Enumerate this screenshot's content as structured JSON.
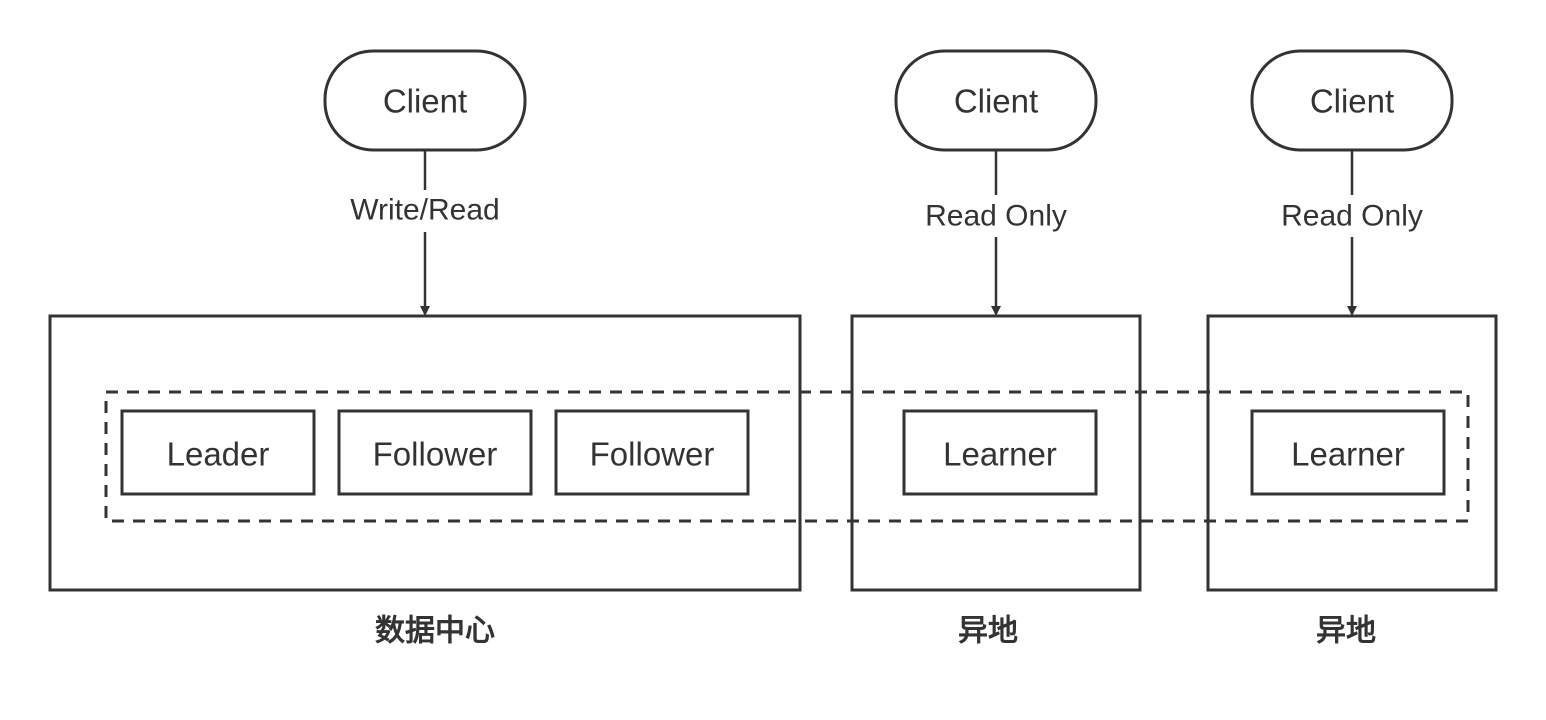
{
  "clients": [
    {
      "label": "Client",
      "edge_label": "Write/Read"
    },
    {
      "label": "Client",
      "edge_label": "Read Only"
    },
    {
      "label": "Client",
      "edge_label": "Read Only"
    }
  ],
  "datacenter": {
    "label": "数据中心",
    "nodes": [
      "Leader",
      "Follower",
      "Follower"
    ]
  },
  "remote1": {
    "label": "异地",
    "node": "Learner"
  },
  "remote2": {
    "label": "异地",
    "node": "Learner"
  },
  "colors": {
    "stroke": "#333333",
    "background": "#ffffff"
  }
}
